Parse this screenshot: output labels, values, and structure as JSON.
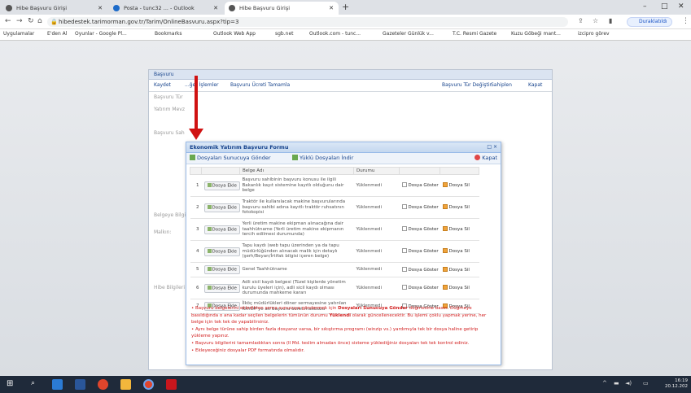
{
  "browser": {
    "tabs": [
      {
        "label": "Hibe Başvuru Girişi"
      },
      {
        "label": "Posta - tunc32 ... - Outlook"
      },
      {
        "label": "Hibe Başvuru Girişi"
      }
    ],
    "url": "hibedestek.tarimorman.gov.tr/Tarim/OnlineBasvuru.aspx?tip=3",
    "paused_label": "Duraklatıldı",
    "bookmarks": [
      "Uygulamalar",
      "E'den Al",
      "Oyunlar - Google Pl...",
      "Bookmarks",
      "Outlook Web App",
      "sgb.net",
      "Outlook.com - tunc...",
      "Gazeteler Günlük v...",
      "T.C. Resmi Gazete",
      "Kuzu Göbeği mant...",
      "izcipro görev"
    ]
  },
  "background_window": {
    "header": "Başvuru",
    "toolbar": {
      "save": "Kaydet",
      "other": "...ğer İşlemler",
      "print": "Başvuru Ücreti Tamamla",
      "change_type": "Başvuru Tür Değiştir",
      "delete": "Sahiplen",
      "close": "Kapat"
    },
    "labels": [
      "Başvuru Tür",
      "Yatırım Mevz",
      "Başvuru Sah",
      "Belgeye Bilgi",
      "Malkın:",
      "Hibe Bilgileri"
    ]
  },
  "modal": {
    "title": "Ekonomik Yatırım Başvuru Formu",
    "controls": "□ ×",
    "send_button": "Dosyaları Sunucuya Gönder",
    "download_button": "Yüklü Dosyaları İndir",
    "close_button": "Kapat",
    "columns": [
      "",
      "Belge Adı",
      "Durumu",
      "",
      ""
    ],
    "attach_label": "Dosya Ekle",
    "show_label": "Dosya Göster",
    "delete_label": "Dosya Sil",
    "rows": [
      {
        "num": "1",
        "name": "Başvuru sahibinin başvuru konusu ile ilgili Bakanlık kayıt sistemine kayıtlı olduğunu dair belge",
        "status": "Yüklenmedi"
      },
      {
        "num": "2",
        "name": "Traktör ile kullanılacak makine başvurularında başvuru sahibi adına kayıtlı traktör ruhsatının fotokopisi",
        "status": "Yüklenmedi"
      },
      {
        "num": "3",
        "name": "Yerli üretim makine ekipman alınacağına dair taahhütname (Yerli üretim makine ekipmanın tercih edilmesi durumunda)",
        "status": "Yüklenmedi"
      },
      {
        "num": "4",
        "name": "Tapu kaydı (web tapu üzerinden ya da tapu müdürlüğünden alınacak malik için detaylı (şerh/Beyan/İrtifak bilgisi içeren belge)",
        "status": "Yüklenmedi"
      },
      {
        "num": "5",
        "name": "Genel Taahhütname",
        "status": "Yüklenmedi"
      },
      {
        "num": "6",
        "name": "Adli sicil kaydı belgesi (Tüzel kişilerde yönetim kurulu üyeleri için), adli sicil kaydı olması durumunda mahkeme kararı",
        "status": "Yüklenmedi"
      },
      {
        "num": "7",
        "name": "İlköç müdürlükleri döner sermayesine yatırılan KKYDP'ye ait başvuru ücret makbuzu",
        "status": "Yüklenmedi"
      }
    ],
    "notes": {
      "n1_a": "• Başvuru belgelerini ekledikten sonra sunucuya göndermek için ",
      "n1_b": "Dosyaları Sunucuya Gönder",
      "n1_c": " düğmesine basın. Düğmeye basıldığında o ana kadar seçilen belgelerin tümünün durumu ",
      "n1_d": "Yüklendi",
      "n1_e": " olarak güncellenecektir. Bu işlemi çoklu yapmak yerine, her belge için tek tek de yapabilirsiniz.",
      "n2": "• Aynı belge türüne sahip birden fazla dosyanız varsa, bir sıkıştırma programı (winzip vs.) yardımıyla tek bir dosya haline getirip yükleme yapınız.",
      "n3": "• Başvuru bilgilerini tamamladıktan sonra (Il Md. teslim almadan önce) sisteme yüklediğiniz dosyaları tek tek kontrol ediniz.",
      "n4": "• Ekleyeceğiniz dosyalar PDF formatında olmalıdır."
    }
  },
  "taskbar": {
    "time": "16:19",
    "date": "20.12.202"
  },
  "colors": {
    "accent": "#15428b",
    "warning_text": "#d22020",
    "arrow": "#d01212"
  }
}
